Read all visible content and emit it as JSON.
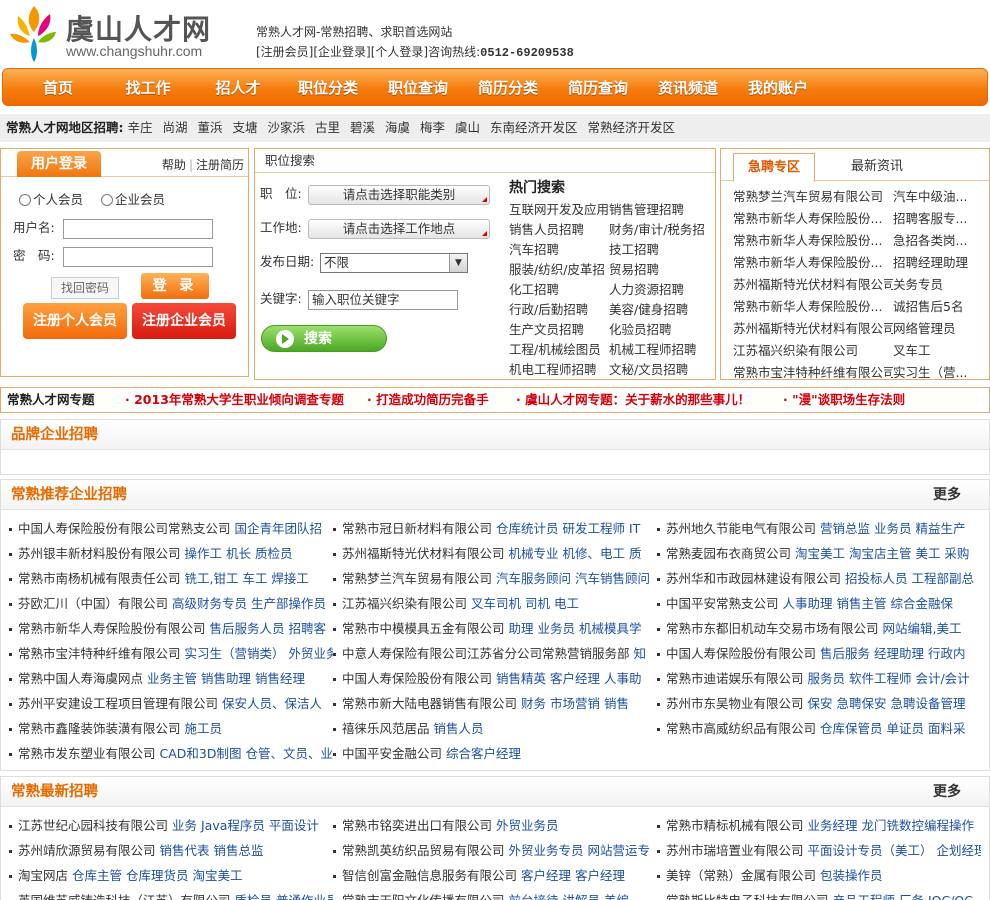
{
  "header": {
    "logo_title": "虞山人才网",
    "logo_url": "www.changshuhr.com",
    "tagline": "常熟人才网-常熟招聘、求职首选网站",
    "register_link": "[注册会员]",
    "company_login_link": "[企业登录]",
    "personal_login_link": "[个人登录]",
    "hotline_label": "咨询热线:",
    "hotline_number": "0512-69209538"
  },
  "nav": {
    "items": [
      "首页",
      "找工作",
      "招人才",
      "职位分类",
      "职位查询",
      "简历分类",
      "简历查询",
      "资讯频道",
      "我的账户"
    ]
  },
  "region": {
    "title": "常熟人才网地区招聘:",
    "items": [
      "辛庄",
      "尚湖",
      "董浜",
      "支塘",
      "沙家浜",
      "古里",
      "碧溪",
      "海虞",
      "梅李",
      "虞山",
      "东南经济开发区",
      "常熟经济开发区"
    ]
  },
  "login": {
    "tab": "用户登录",
    "help": "帮助",
    "register_resume": "注册简历",
    "radio_personal": "个人会员",
    "radio_company": "企业会员",
    "username_label": "用户名:",
    "password_label": "密　码:",
    "forgot": "找回密码",
    "login_btn": "登 录",
    "reg_personal": "注册个人会员",
    "reg_company": "注册企业会员"
  },
  "jobsearch": {
    "title": "职位搜索",
    "position_label": "职　位:",
    "position_btn": "请点击选择职能类别",
    "location_label": "工作地:",
    "location_btn": "请点击选择工作地点",
    "date_label": "发布日期:",
    "date_value": "不限",
    "keyword_label": "关键字:",
    "keyword_value": "输入职位关键字",
    "search_btn": "搜索",
    "hot_title": "热门搜索",
    "hot_items": [
      "互联网开发及应用",
      "销售管理招聘",
      "销售人员招聘",
      "财务/审计/税务招",
      "汽车招聘",
      "技工招聘",
      "服装/纺织/皮革招",
      "贸易招聘",
      "化工招聘",
      "人力资源招聘",
      "行政/后勤招聘",
      "美容/健身招聘",
      "生产文员招聘",
      "化验员招聘",
      "工程/机械绘图员",
      "机械工程师招聘",
      "机电工程师招聘",
      "文秘/文员招聘"
    ]
  },
  "urgent": {
    "tab_urgent": "急聘专区",
    "tab_news": "最新资讯",
    "items": [
      {
        "company": "常熟梦兰汽车贸易有限公司",
        "position": "汽车中级油..."
      },
      {
        "company": "常熟市新华人寿保险股份...",
        "position": "招聘客服专..."
      },
      {
        "company": "常熟市新华人寿保险股份...",
        "position": "急招各类岗..."
      },
      {
        "company": "常熟市新华人寿保险股份...",
        "position": "招聘经理助理"
      },
      {
        "company": "苏州福斯特光伏材料有限公司",
        "position": "关务专员"
      },
      {
        "company": "常熟市新华人寿保险股份...",
        "position": "诚招售后5名"
      },
      {
        "company": "苏州福斯特光伏材料有限公司",
        "position": "网络管理员"
      },
      {
        "company": "江苏福兴织染有限公司",
        "position": "叉车工"
      },
      {
        "company": "常熟市宝沣特种纤维有限公司",
        "position": "实习生（营..."
      }
    ]
  },
  "topics": {
    "title": "常熟人才网专题",
    "items": [
      "· 2013年常熟大学生职业倾向调查专题",
      "· 打造成功简历完备手",
      "· 虞山人才网专题：关于薪水的那些事儿！",
      "· \"漫\"谈职场生存法则"
    ]
  },
  "brand_section": {
    "title": "品牌企业招聘"
  },
  "recommend_section": {
    "title": "常熟推荐企业招聘",
    "more": "更多",
    "items": [
      {
        "company": "中国人寿保险股份有限公司常熟支公司",
        "positions": "国企青年团队招"
      },
      {
        "company": "常熟市冠日新材料有限公司",
        "positions": "仓库统计员  研发工程师  IT"
      },
      {
        "company": "苏州地久节能电气有限公司",
        "positions": "营销总监  业务员  精益生产"
      },
      {
        "company": "苏州银丰新材料股份有限公司",
        "positions": "操作工  机长  质检员"
      },
      {
        "company": "苏州福斯特光伏材料有限公司",
        "positions": "机械专业  机修、电工  质"
      },
      {
        "company": "常熟麦园布衣商贸公司",
        "positions": "淘宝美工  淘宝店主管  美工  采购"
      },
      {
        "company": "常熟市南杨机械有限责任公司",
        "positions": "铣工,钳工  车工  焊接工"
      },
      {
        "company": "常熟梦兰汽车贸易有限公司",
        "positions": "汽车服务顾问  汽车销售顾问"
      },
      {
        "company": "苏州华和市政园林建设有限公司",
        "positions": "招投标人员  工程部副总"
      },
      {
        "company": "芬欧汇川（中国）有限公司",
        "positions": "高级财务专员  生产部操作员"
      },
      {
        "company": "江苏福兴织染有限公司",
        "positions": "叉车司机  司机  电工"
      },
      {
        "company": "中国平安常熟支公司",
        "positions": "人事助理  销售主管  综合金融保"
      },
      {
        "company": "常熟市新华人寿保险股份有限公司",
        "positions": "售后服务人员  招聘客"
      },
      {
        "company": "常熟市中模模具五金有限公司",
        "positions": "助理  业务员  机械模具学"
      },
      {
        "company": "常熟市东都旧机动车交易市场有限公司",
        "positions": "网站编辑,美工"
      },
      {
        "company": "常熟市宝沣特种纤维有限公司",
        "positions": "实习生（营销类）  外贸业务"
      },
      {
        "company": "中意人寿保险有限公司江苏省分公司常熟营销服务部",
        "positions": "知"
      },
      {
        "company": "中国人寿保险股份有限公司",
        "positions": "售后服务  经理助理  行政内"
      },
      {
        "company": "常熟中国人寿海虞网点",
        "positions": "业务主管  销售助理  销售经理"
      },
      {
        "company": "中国人寿保险股份有限公司",
        "positions": "销售精英  客户经理  人事助"
      },
      {
        "company": "常熟市迪诺娱乐有限公司",
        "positions": "服务员  软件工程师  会计/会计"
      },
      {
        "company": "苏州平安建设工程项目管理有限公司",
        "positions": "保安人员、保洁人"
      },
      {
        "company": "常熟市新大陆电器销售有限公司",
        "positions": "财务  市场营销  销售"
      },
      {
        "company": "苏州市东吴物业有限公司",
        "positions": "保安  急聘保安  急聘设备管理"
      },
      {
        "company": "常熟市鑫隆装饰装潢有限公司",
        "positions": "施工员"
      },
      {
        "company": "禧徕乐风范居品",
        "positions": "销售人员"
      },
      {
        "company": "常熟市高威纺织品有限公司",
        "positions": "仓库保管员  单证员  面料采"
      },
      {
        "company": "常熟市发东塑业有限公司",
        "positions": "CAD和3D制图  仓管、文员、业"
      },
      {
        "company": "中国平安金融公司",
        "positions": "综合客户经理"
      }
    ]
  },
  "latest_section": {
    "title": "常熟最新招聘",
    "more": "更多",
    "items": [
      {
        "company": "江苏世纪心园科技有限公司",
        "positions": "业务  Java程序员  平面设计"
      },
      {
        "company": "常熟市铭奕进出口有限公司",
        "positions": "外贸业务员"
      },
      {
        "company": "常熟市精标机械有限公司",
        "positions": "业务经理  龙门铣数控编程操作"
      },
      {
        "company": "苏州靖欣源贸易有限公司",
        "positions": "销售代表  销售总监"
      },
      {
        "company": "常熟凯英纺织品贸易有限公司",
        "positions": "外贸业务专员  网站营运专"
      },
      {
        "company": "苏州市瑞培置业有限公司",
        "positions": "平面设计专员（美工）  企划经理"
      },
      {
        "company": "淘宝网店",
        "positions": "仓库主管  仓库理货员  淘宝美工"
      },
      {
        "company": "智信创富金融信息服务有限公司",
        "positions": "客户经理  客户经理"
      },
      {
        "company": "美锌（常熟）金属有限公司",
        "positions": "包装操作员"
      },
      {
        "company": "英国维苏威铸造科技（江苏）有限公司",
        "positions": "质检员  普通作业员"
      },
      {
        "company": "常熟市天阳文化传播有限公司",
        "positions": "前台接待  讲解员  美编"
      },
      {
        "company": "常熟斯比特电子科技有限公司",
        "positions": "产品工程师  厂务  IQC/QC"
      }
    ]
  }
}
